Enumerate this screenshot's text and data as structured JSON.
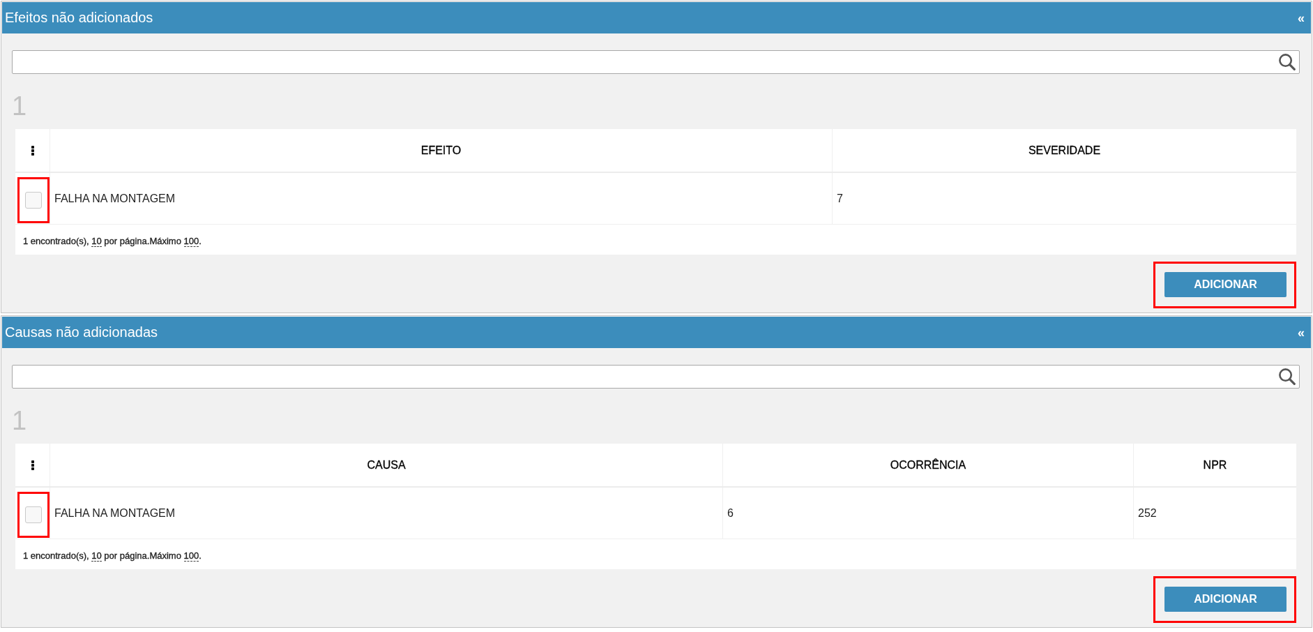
{
  "panels": [
    {
      "title": "Efeitos não adicionados",
      "collapse_glyph": "«",
      "page_number": "1",
      "table": {
        "columns": [
          "EFEITO",
          "SEVERIDADE"
        ],
        "rows": [
          {
            "checked": false,
            "highlighted": true,
            "cells": [
              "FALHA NA MONTAGEM",
              "7"
            ]
          }
        ],
        "summary": [
          {
            "kind": "text",
            "text": "1 encontrado(s), "
          },
          {
            "kind": "link",
            "text": "10"
          },
          {
            "kind": "text",
            "text": " por página.Máximo "
          },
          {
            "kind": "link",
            "text": "100"
          },
          {
            "kind": "text",
            "text": "."
          }
        ]
      },
      "add_button": {
        "label": "ADICIONAR",
        "highlighted": true
      }
    },
    {
      "title": "Causas não adicionadas",
      "collapse_glyph": "«",
      "page_number": "1",
      "table": {
        "columns": [
          "CAUSA",
          "OCORRÊNCIA",
          "NPR"
        ],
        "rows": [
          {
            "checked": false,
            "highlighted": true,
            "cells": [
              "FALHA NA MONTAGEM",
              "6",
              "252"
            ]
          }
        ],
        "summary": [
          {
            "kind": "text",
            "text": "1 encontrado(s), "
          },
          {
            "kind": "link",
            "text": "10"
          },
          {
            "kind": "text",
            "text": " por página.Máximo "
          },
          {
            "kind": "link",
            "text": "100"
          },
          {
            "kind": "text",
            "text": "."
          }
        ]
      },
      "add_button": {
        "label": "ADICIONAR",
        "highlighted": true
      }
    }
  ]
}
